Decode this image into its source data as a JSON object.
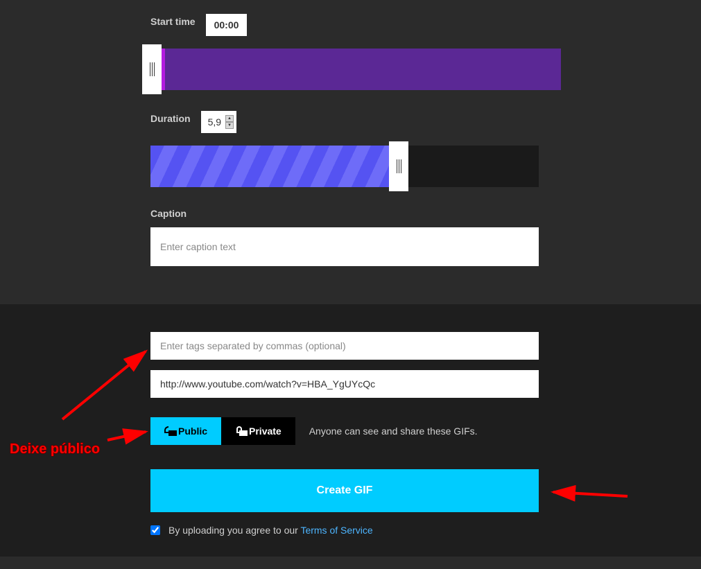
{
  "start_time": {
    "label": "Start time",
    "value": "00:00"
  },
  "duration": {
    "label": "Duration",
    "value": "5,9"
  },
  "caption": {
    "label": "Caption",
    "placeholder": "Enter caption text"
  },
  "tags": {
    "placeholder": "Enter tags separated by commas (optional)"
  },
  "source_url": {
    "value": "http://www.youtube.com/watch?v=HBA_YgUYcQc"
  },
  "privacy": {
    "public_label": "Public",
    "private_label": "Private",
    "description": "Anyone can see and share these GIFs."
  },
  "create_button": "Create GIF",
  "agree": {
    "prefix": "By uploading you agree to our ",
    "link": "Terms of Service"
  },
  "annotations": {
    "public_label": "Deixe público"
  }
}
